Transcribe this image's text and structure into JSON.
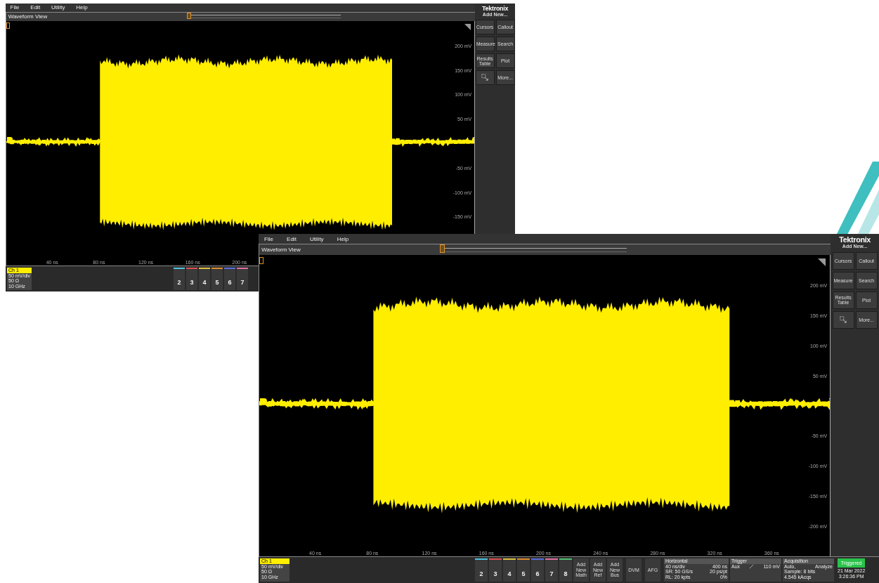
{
  "screens": [
    {
      "menu": [
        "File",
        "Edit",
        "Utility",
        "Help"
      ],
      "view_title": "Waveform View",
      "y_labels": [
        "200 mV",
        "150 mV",
        "100 mV",
        "50 mV",
        "-50 mV",
        "-100 mV",
        "-150 mV"
      ],
      "x_labels": [
        "40 ns",
        "80 ns",
        "120 ns",
        "160 ns",
        "200 ns"
      ],
      "panel": {
        "brand": "Tektronix",
        "add_new": "Add New...",
        "buttons": [
          {
            "kind": "text",
            "label": "Cursors"
          },
          {
            "kind": "text",
            "label": "Callout"
          },
          {
            "kind": "text",
            "label": "Measure"
          },
          {
            "kind": "text",
            "label": "Search"
          },
          {
            "kind": "text",
            "label": "Results Table"
          },
          {
            "kind": "text",
            "label": "Plot"
          },
          {
            "kind": "icon"
          },
          {
            "kind": "text",
            "label": "More..."
          }
        ]
      },
      "status": {
        "channel": {
          "label": "Ch 1",
          "lines": [
            "50 mV/div",
            "50 Ω",
            "10 GHz"
          ]
        },
        "channel_buttons": [
          {
            "label": "2",
            "color": "#4fc3e0"
          },
          {
            "label": "3",
            "color": "#e05050"
          },
          {
            "label": "4",
            "color": "#e0c040"
          },
          {
            "label": "5",
            "color": "#e08a30"
          },
          {
            "label": "6",
            "color": "#5a6ee0"
          },
          {
            "label": "7",
            "color": "#e070a0"
          }
        ]
      }
    },
    {
      "menu": [
        "File",
        "Edit",
        "Utility",
        "Help"
      ],
      "view_title": "Waveform View",
      "y_labels": [
        "200 mV",
        "150 mV",
        "100 mV",
        "50 mV",
        "-50 mV",
        "-100 mV",
        "-150 mV",
        "-200 mV"
      ],
      "x_labels": [
        "40 ns",
        "80 ns",
        "120 ns",
        "160 ns",
        "200 ns",
        "240 ns",
        "280 ns",
        "320 ns",
        "360 ns"
      ],
      "panel": {
        "brand": "Tektronix",
        "add_new": "Add New...",
        "buttons": [
          {
            "kind": "text",
            "label": "Cursors"
          },
          {
            "kind": "text",
            "label": "Callout"
          },
          {
            "kind": "text",
            "label": "Measure"
          },
          {
            "kind": "text",
            "label": "Search"
          },
          {
            "kind": "text",
            "label": "Results Table"
          },
          {
            "kind": "text",
            "label": "Plot"
          },
          {
            "kind": "icon"
          },
          {
            "kind": "text",
            "label": "More..."
          }
        ]
      },
      "status": {
        "channel": {
          "label": "Ch 1",
          "lines": [
            "50 mV/div",
            "50 Ω",
            "10 GHz"
          ]
        },
        "channel_buttons": [
          {
            "label": "2",
            "color": "#4fc3e0"
          },
          {
            "label": "3",
            "color": "#e05050"
          },
          {
            "label": "4",
            "color": "#e0c040"
          },
          {
            "label": "5",
            "color": "#e08a30"
          },
          {
            "label": "6",
            "color": "#5a6ee0"
          },
          {
            "label": "7",
            "color": "#e070a0"
          },
          {
            "label": "8",
            "color": "#50c070"
          }
        ],
        "add_buttons": [
          [
            "Add",
            "New",
            "Math"
          ],
          [
            "Add",
            "New",
            "Ref"
          ],
          [
            "Add",
            "New",
            "Bus"
          ]
        ],
        "tools": [
          "DVM",
          "AFG"
        ],
        "horizontal": {
          "title": "Horizontal",
          "rows": [
            [
              "40 ns/div",
              "400 ns"
            ],
            [
              "SR: 50 GS/s",
              "20 ps/pt"
            ],
            [
              "RL: 20 kpts",
              "0%"
            ]
          ]
        },
        "trigger": {
          "title": "Trigger",
          "source": "Aux",
          "threshold": "110 mV"
        },
        "acquisition": {
          "title": "Acquisition",
          "rows": [
            [
              "Auto,",
              "Analyze"
            ],
            [
              "Sample: 8 bits"
            ],
            [
              "4.545 kAcqs"
            ]
          ]
        },
        "run_state": "Triggered",
        "date": "21 Mar 2022",
        "time": "3:26:36 PM"
      }
    }
  ]
}
